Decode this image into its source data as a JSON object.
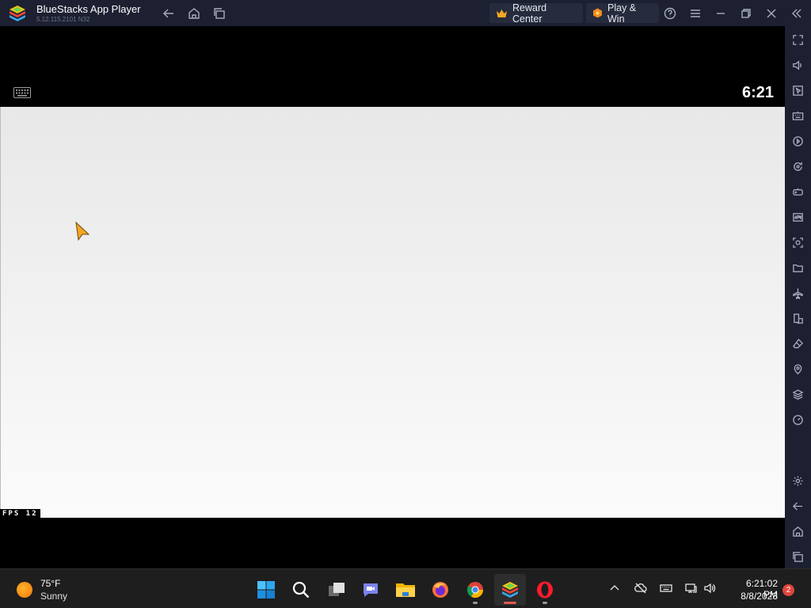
{
  "window": {
    "title": "BlueStacks App Player",
    "version": "5.12.115.2101  N32",
    "reward_center_label": "Reward Center",
    "play_win_label": "Play & Win"
  },
  "screen": {
    "clock": "6:21",
    "fps_label": "FPS  12"
  },
  "sidebar": {
    "items": [
      "fullscreen",
      "volume",
      "cursor",
      "keyboard-controls",
      "macro-recorder",
      "sync",
      "game-controls",
      "install-apk",
      "screenshot",
      "media-folder",
      "airplane-mode",
      "rotate",
      "eco-mode",
      "location",
      "multi-instance",
      "performance",
      "settings",
      "back",
      "home",
      "recent-apps"
    ]
  },
  "taskbar": {
    "temperature": "75°F",
    "condition": "Sunny",
    "time": "6:21:02 PM",
    "date": "8/8/2023",
    "notification_count": "2",
    "apps": [
      "start",
      "search",
      "task-view",
      "teams-chat",
      "file-explorer",
      "firefox",
      "chrome",
      "bluestacks",
      "opera"
    ]
  },
  "colors": {
    "titlebar_bg": "#1c2031",
    "accent_orange": "#f5a623",
    "badge_red": "#e0453e"
  }
}
